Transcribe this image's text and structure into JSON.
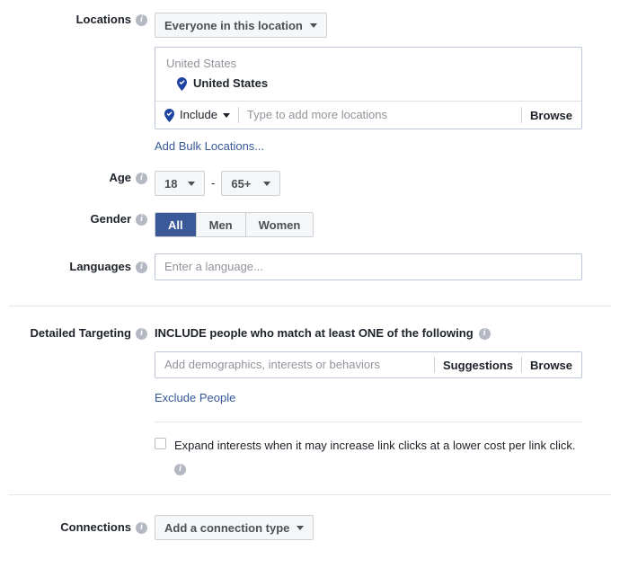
{
  "colors": {
    "accent_blue": "#3b5998",
    "link_blue": "#365899",
    "pin_blue": "#1d43a2",
    "text": "#1d2129",
    "muted": "#90949c",
    "border": "#bdc7d8",
    "button_bg": "#f6f7f9"
  },
  "locations": {
    "label": "Locations",
    "scope_button": "Everyone in this location",
    "group_title": "United States",
    "selected_location": "United States",
    "include_label": "Include",
    "input_placeholder": "Type to add more locations",
    "browse_label": "Browse",
    "bulk_link": "Add Bulk Locations..."
  },
  "age": {
    "label": "Age",
    "min": "18",
    "separator": "-",
    "max": "65+"
  },
  "gender": {
    "label": "Gender",
    "options": [
      {
        "label": "All",
        "selected": true
      },
      {
        "label": "Men",
        "selected": false
      },
      {
        "label": "Women",
        "selected": false
      }
    ]
  },
  "languages": {
    "label": "Languages",
    "placeholder": "Enter a language..."
  },
  "detailed_targeting": {
    "label": "Detailed Targeting",
    "headline": "INCLUDE people who match at least ONE of the following",
    "input_placeholder": "Add demographics, interests or behaviors",
    "suggestions_label": "Suggestions",
    "browse_label": "Browse",
    "exclude_link": "Exclude People",
    "expand_checkbox_label": "Expand interests when it may increase link clicks at a lower cost per link click.",
    "expand_checked": false
  },
  "connections": {
    "label": "Connections",
    "button": "Add a connection type"
  }
}
